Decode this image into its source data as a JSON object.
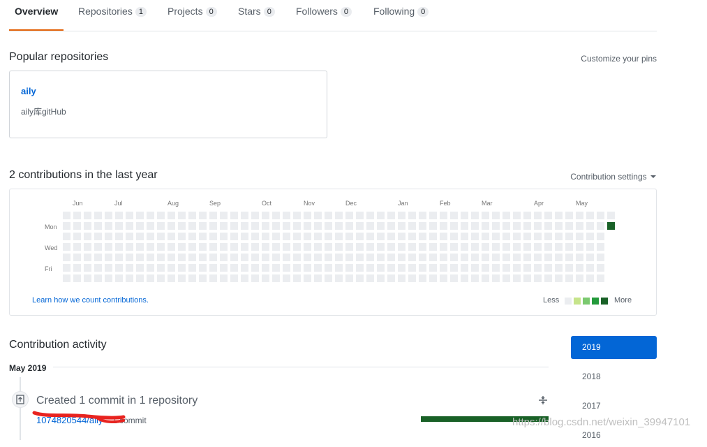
{
  "tabs": [
    {
      "label": "Overview",
      "count": "",
      "selected": true
    },
    {
      "label": "Repositories",
      "count": "1"
    },
    {
      "label": "Projects",
      "count": "0"
    },
    {
      "label": "Stars",
      "count": "0"
    },
    {
      "label": "Followers",
      "count": "0"
    },
    {
      "label": "Following",
      "count": "0"
    }
  ],
  "popular": {
    "title": "Popular repositories",
    "customize_label": "Customize your pins",
    "repo": {
      "name": "aily",
      "description": "aily库gitHub"
    }
  },
  "contributions": {
    "title": "2 contributions in the last year",
    "settings_label": "Contribution settings",
    "months": [
      "Jun",
      "Jul",
      "Aug",
      "Sep",
      "Oct",
      "Nov",
      "Dec",
      "Jan",
      "Feb",
      "Mar",
      "Apr",
      "May"
    ],
    "weekdays": [
      "Mon",
      "Wed",
      "Fri"
    ],
    "learn_link": "Learn how we count contributions.",
    "legend_less": "Less",
    "legend_more": "More",
    "levels": [
      "#ebedf0",
      "#c6e48b",
      "#7bc96f",
      "#239a3b",
      "#196127"
    ]
  },
  "activity": {
    "title": "Contribution activity",
    "month_heading": "May 2019",
    "entry_title": "Created 1 commit in 1 repository",
    "repo_link": "1074820544/aily",
    "commit_count": "1 commit",
    "bar_color": "#196127"
  },
  "years": [
    {
      "label": "2019",
      "active": true
    },
    {
      "label": "2018"
    },
    {
      "label": "2017"
    },
    {
      "label": "2016"
    }
  ],
  "watermark": "https://blog.csdn.net/weixin_39947101"
}
